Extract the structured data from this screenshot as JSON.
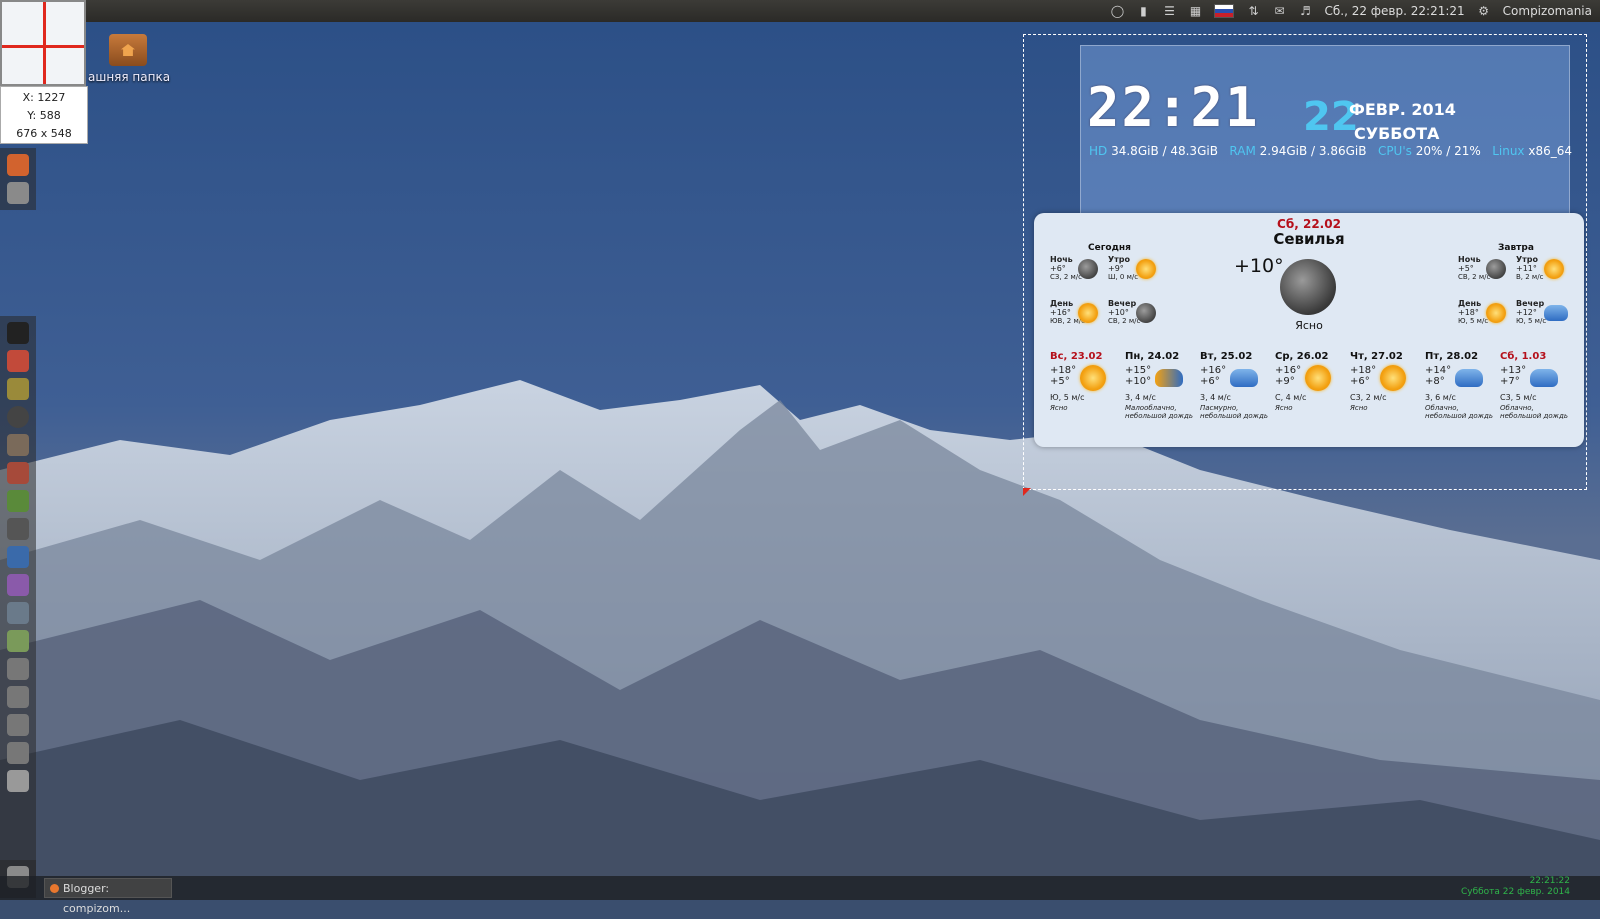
{
  "topbar": {
    "datetime": "Сб., 22 февр. 22:21:21",
    "user": "Compizomania",
    "icons": [
      "lightbulb-icon",
      "thermometer-icon",
      "menu-icon",
      "keyboard-icon",
      "flag-icon",
      "arrows-icon",
      "mail-icon",
      "volume-icon",
      "gear-icon"
    ]
  },
  "magnifier": {
    "x": "X: 1227",
    "y": "Y: 588",
    "size": "676 x 548"
  },
  "desktop": {
    "folder_label": "ашняя папка"
  },
  "conky": {
    "time": "22:21",
    "day": "22",
    "month": "ФЕВР. 2014",
    "weekday": "СУББОТА",
    "hd_label": "HD",
    "hd_value": "34.8GiB / 48.3GiB",
    "ram_label": "RAM",
    "ram_value": "2.94GiB / 3.86GiB",
    "cpu_label": "CPU's",
    "cpu_value": "20% / 21%",
    "os_label": "Linux",
    "os_value": "x86_64"
  },
  "weather": {
    "date": "Сб, 22.02",
    "city": "Севилья",
    "current_temp": "+10°",
    "current_desc": "Ясно",
    "today": {
      "title": "Сегодня",
      "slots": [
        {
          "name": "Ночь",
          "temp": "+6°",
          "wind": "СЗ, 2 м/с",
          "icon": "moon"
        },
        {
          "name": "Утро",
          "temp": "+9°",
          "wind": "Ш, 0 м/с",
          "icon": "sun"
        },
        {
          "name": "День",
          "temp": "+16°",
          "wind": "ЮВ, 2 м/с",
          "icon": "sun"
        },
        {
          "name": "Вечер",
          "temp": "+10°",
          "wind": "СВ, 2 м/с",
          "icon": "moon"
        }
      ]
    },
    "tomorrow": {
      "title": "Завтра",
      "slots": [
        {
          "name": "Ночь",
          "temp": "+5°",
          "wind": "СВ, 2 м/с",
          "icon": "moon"
        },
        {
          "name": "Утро",
          "temp": "+11°",
          "wind": "В, 2 м/с",
          "icon": "sun"
        },
        {
          "name": "День",
          "temp": "+18°",
          "wind": "Ю, 5 м/с",
          "icon": "sun"
        },
        {
          "name": "Вечер",
          "temp": "+12°",
          "wind": "Ю, 5 м/с",
          "icon": "cloud"
        }
      ]
    },
    "forecast": [
      {
        "day": "Вс, 23.02",
        "hi": "+18°",
        "lo": "+5°",
        "wind": "Ю, 5 м/с",
        "desc1": "Ясно",
        "desc2": "",
        "icon": "sun",
        "red": true
      },
      {
        "day": "Пн, 24.02",
        "hi": "+15°",
        "lo": "+10°",
        "wind": "3, 4 м/с",
        "desc1": "Малооблачно,",
        "desc2": "небольшой дождь",
        "icon": "cloud",
        "red": false
      },
      {
        "day": "Вт, 25.02",
        "hi": "+16°",
        "lo": "+6°",
        "wind": "3, 4 м/с",
        "desc1": "Пасмурно,",
        "desc2": "небольшой дождь",
        "icon": "cloud",
        "red": false
      },
      {
        "day": "Ср, 26.02",
        "hi": "+16°",
        "lo": "+9°",
        "wind": "С, 4 м/с",
        "desc1": "Ясно",
        "desc2": "",
        "icon": "sun",
        "red": false
      },
      {
        "day": "Чт, 27.02",
        "hi": "+18°",
        "lo": "+6°",
        "wind": "С3, 2 м/с",
        "desc1": "Ясно",
        "desc2": "",
        "icon": "sun",
        "red": false
      },
      {
        "day": "Пт, 28.02",
        "hi": "+14°",
        "lo": "+8°",
        "wind": "3, 6 м/с",
        "desc1": "Облачно,",
        "desc2": "небольшой дождь",
        "icon": "cloud",
        "red": false
      },
      {
        "day": "Сб, 1.03",
        "hi": "+13°",
        "lo": "+7°",
        "wind": "С3, 5 м/с",
        "desc1": "Облачно,",
        "desc2": "небольшой дождь",
        "icon": "cloud",
        "red": true
      }
    ]
  },
  "taskbar": {
    "task_label": "Blogger: compizom...",
    "clock_line1": "22:21:22",
    "clock_line2": "Суббота 22 февр. 2014"
  },
  "colors": {
    "accent": "#4fc6f0",
    "red": "#b5101b",
    "clock_green": "#2fb44a"
  }
}
